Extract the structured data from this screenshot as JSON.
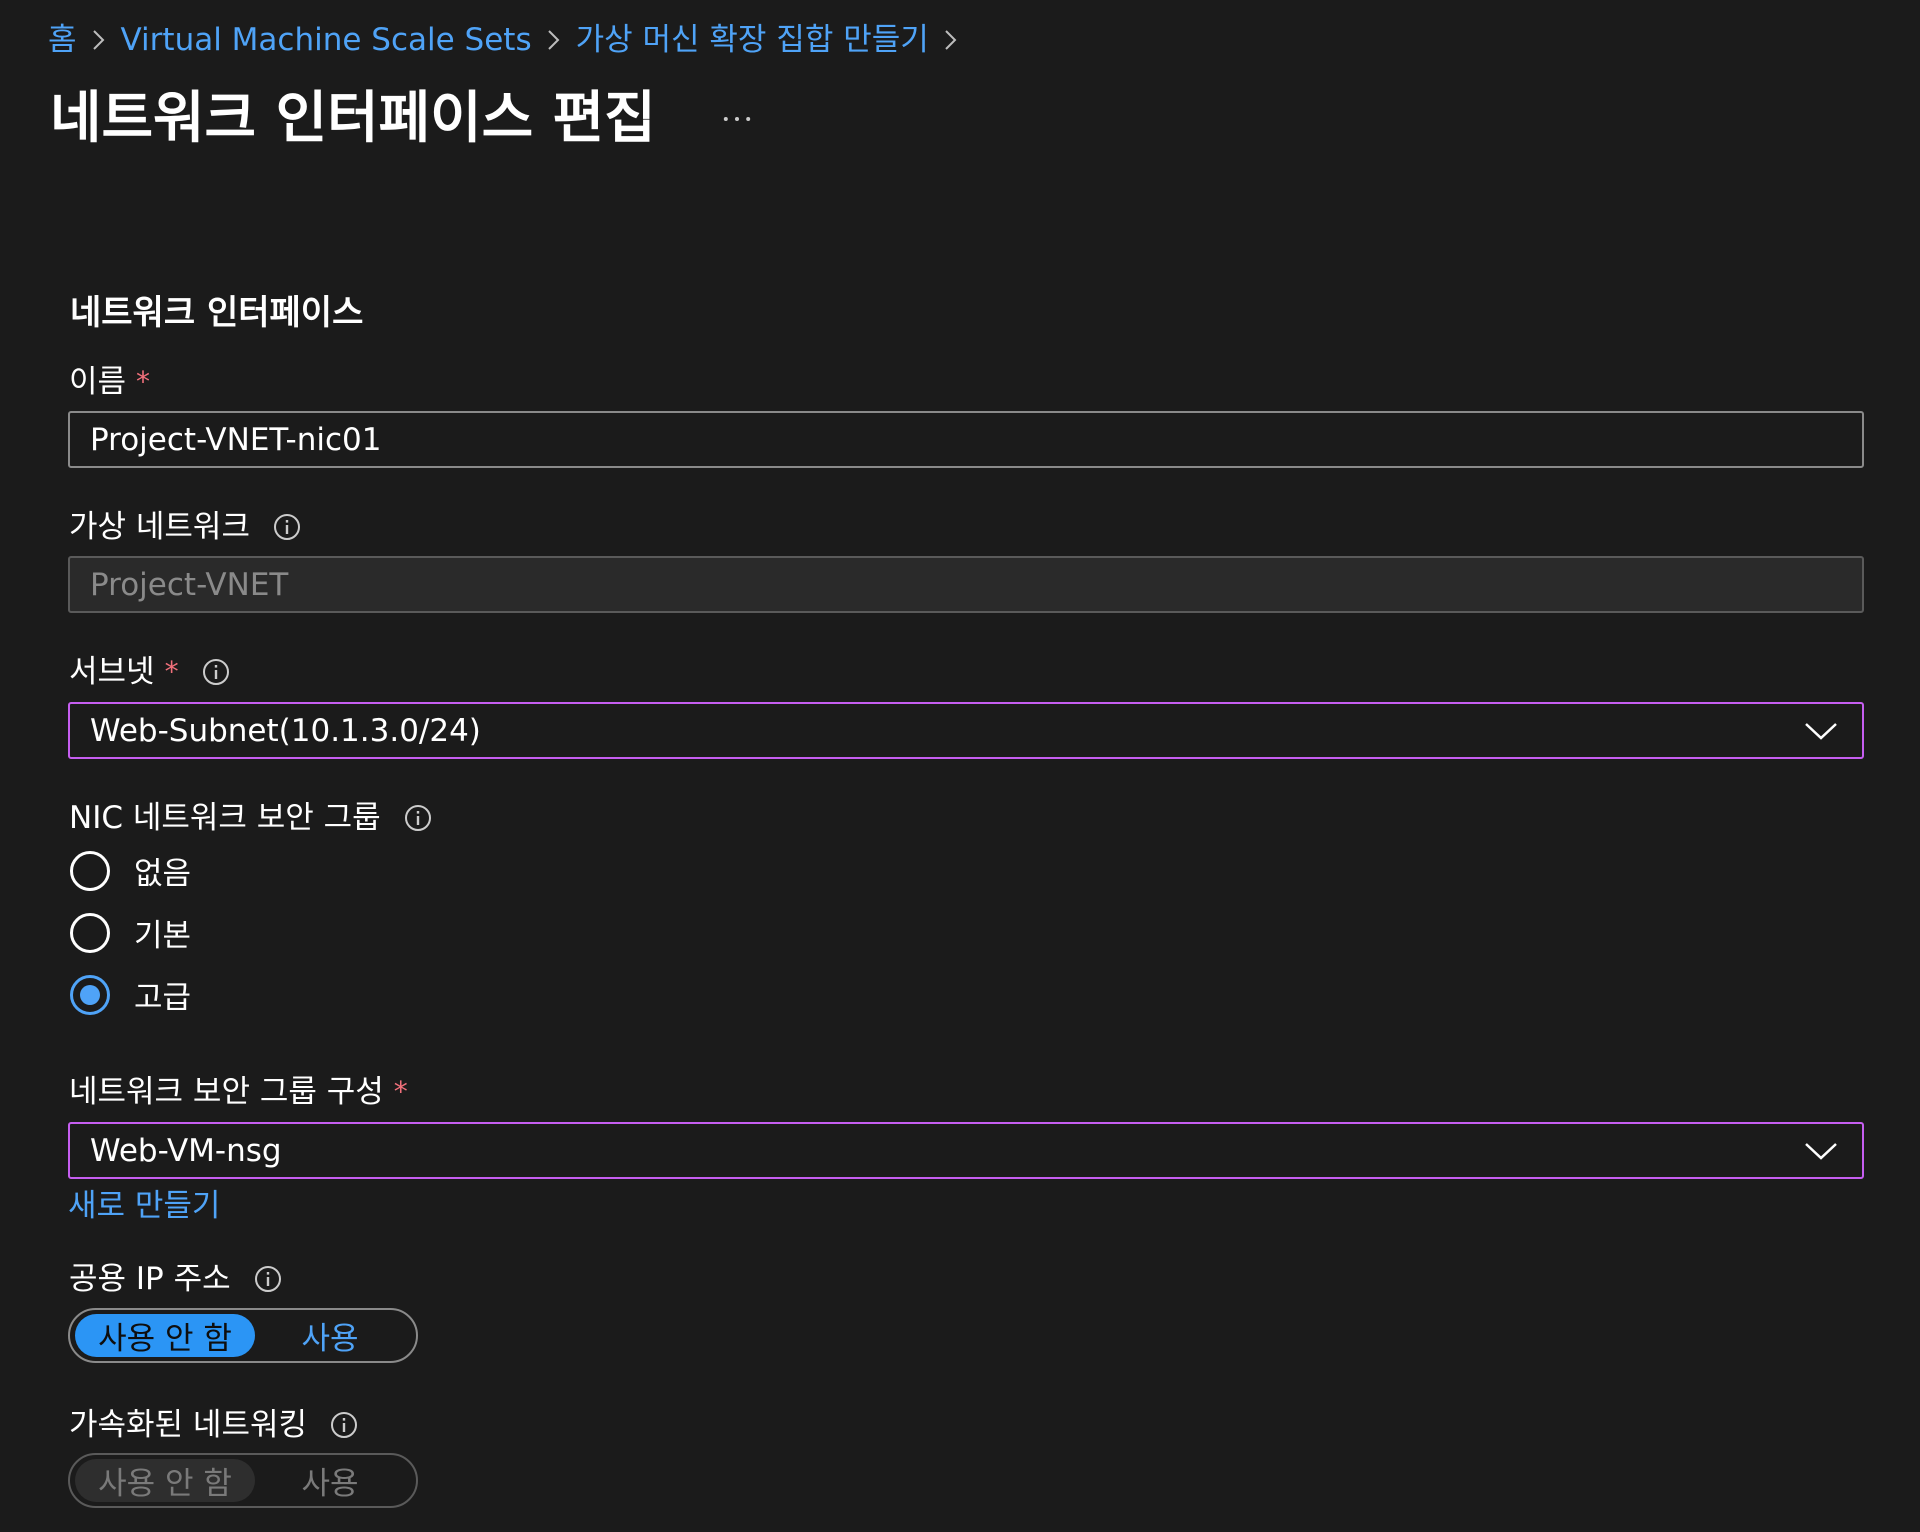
{
  "breadcrumb": {
    "items": [
      "홈",
      "Virtual Machine Scale Sets",
      "가상 머신 확장 집합 만들기"
    ]
  },
  "header": {
    "title": "네트워크 인터페이스 편집",
    "more": "..."
  },
  "section": {
    "heading": "네트워크 인터페이스"
  },
  "form": {
    "name": {
      "label": "이름",
      "required": "*",
      "value": "Project-VNET-nic01"
    },
    "vnet": {
      "label": "가상 네트워크",
      "value": "Project-VNET"
    },
    "subnet": {
      "label": "서브넷",
      "required": "*",
      "value": "Web-Subnet(10.1.3.0/24)"
    },
    "nsg_type": {
      "label": "NIC 네트워크 보안 그룹",
      "options": [
        "없음",
        "기본",
        "고급"
      ],
      "selected": "고급"
    },
    "nsg_config": {
      "label": "네트워크 보안 그룹 구성",
      "required": "*",
      "value": "Web-VM-nsg",
      "create_new": "새로 만들기"
    },
    "public_ip": {
      "label": "공용 IP 주소",
      "off_label": "사용 안 함",
      "on_label": "사용",
      "selected": "사용 안 함"
    },
    "accel_net": {
      "label": "가속화된 네트워킹",
      "off_label": "사용 안 함",
      "on_label": "사용",
      "selected": "사용 안 함"
    }
  },
  "colors": {
    "background": "#1b1b1b",
    "link": "#4fa3f7",
    "focus_border": "#c65ef0",
    "required": "#f1707b",
    "toggle_selected": "#2b95f5"
  },
  "icons": [
    "chevron-right-icon",
    "more-icon",
    "info-icon",
    "chevron-down-icon"
  ]
}
